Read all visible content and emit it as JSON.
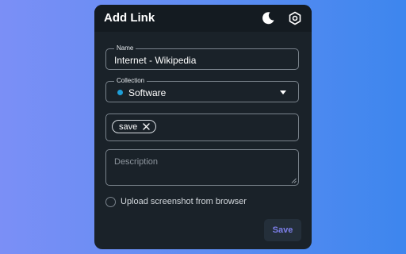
{
  "header": {
    "title": "Add Link",
    "icons": [
      "moon-icon",
      "gear-icon"
    ]
  },
  "form": {
    "name": {
      "label": "Name",
      "value": "Internet - Wikipedia"
    },
    "collection": {
      "label": "Collection",
      "value": "Software",
      "color": "#1e9fd8"
    },
    "tags": [
      {
        "label": "save"
      }
    ],
    "description": {
      "placeholder": "Description",
      "value": ""
    },
    "upload_screenshot": {
      "label": "Upload screenshot from browser",
      "checked": false
    },
    "save_label": "Save"
  },
  "colors": {
    "panel": "#1a2229",
    "header": "#141b21",
    "save_text": "#7c7ee8",
    "background_from": "#7b8ff6",
    "background_to": "#3d86ee"
  }
}
